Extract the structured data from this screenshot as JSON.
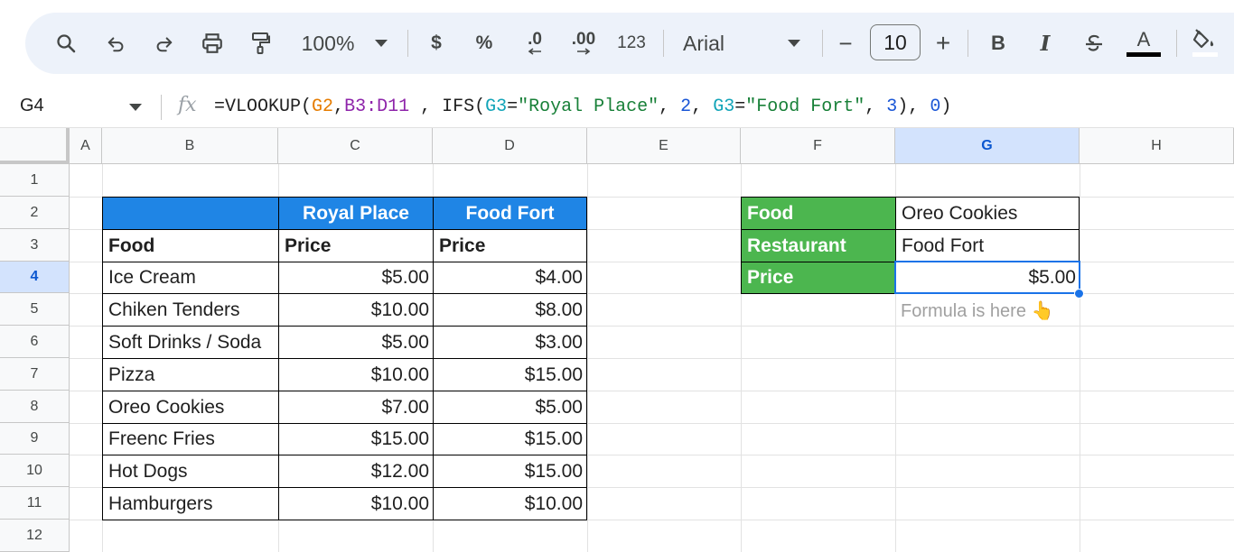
{
  "toolbar": {
    "zoom": "100%",
    "currency": "$",
    "percent": "%",
    "decrease_decimals": ".0",
    "increase_decimals": ".00",
    "more_formats": "123",
    "font": "Arial",
    "font_size": "10",
    "minus": "−",
    "plus": "+",
    "bold": "B",
    "italic": "I",
    "text_color": "A"
  },
  "formula_bar": {
    "cell_ref": "G4",
    "fx": "fx",
    "parts": {
      "p1": "=VLOOKUP(",
      "p2": "G2",
      "p3": ",",
      "p4": "B3:D11",
      "p5": " , IFS(",
      "p6": "G3",
      "p7": "=",
      "p8": "\"Royal Place\"",
      "p9": ", ",
      "p10": "2",
      "p11": ", ",
      "p12": "G3",
      "p13": "=",
      "p14": "\"Food Fort\"",
      "p15": ", ",
      "p16": "3",
      "p17": "), ",
      "p18": "0",
      "p19": ")"
    }
  },
  "columns": [
    "A",
    "B",
    "C",
    "D",
    "E",
    "F",
    "G",
    "H"
  ],
  "rows": [
    "1",
    "2",
    "3",
    "4",
    "5",
    "6",
    "7",
    "8",
    "9",
    "10",
    "11",
    "12"
  ],
  "table": {
    "header_restaurants": [
      "Royal Place",
      "Food Fort"
    ],
    "subheader": [
      "Food",
      "Price",
      "Price"
    ],
    "items": [
      {
        "food": "Ice Cream",
        "royal": "$5.00",
        "fort": "$4.00"
      },
      {
        "food": "Chiken Tenders",
        "royal": "$10.00",
        "fort": "$8.00"
      },
      {
        "food": "Soft Drinks / Soda",
        "royal": "$5.00",
        "fort": "$3.00"
      },
      {
        "food": "Pizza",
        "royal": "$10.00",
        "fort": "$15.00"
      },
      {
        "food": "Oreo Cookies",
        "royal": "$7.00",
        "fort": "$5.00"
      },
      {
        "food": "Freenc Fries",
        "royal": "$15.00",
        "fort": "$15.00"
      },
      {
        "food": "Hot Dogs",
        "royal": "$12.00",
        "fort": "$15.00"
      },
      {
        "food": "Hamburgers",
        "royal": "$10.00",
        "fort": "$10.00"
      }
    ]
  },
  "lookup": {
    "food_label": "Food",
    "food_value": "Oreo Cookies",
    "restaurant_label": "Restaurant",
    "restaurant_value": "Food Fort",
    "price_label": "Price",
    "price_value": "$5.00",
    "note": "Formula is here 👆"
  },
  "colors": {
    "header_blue": "#1f85e5",
    "label_green": "#4cb64f",
    "selection": "#1a73e8"
  }
}
